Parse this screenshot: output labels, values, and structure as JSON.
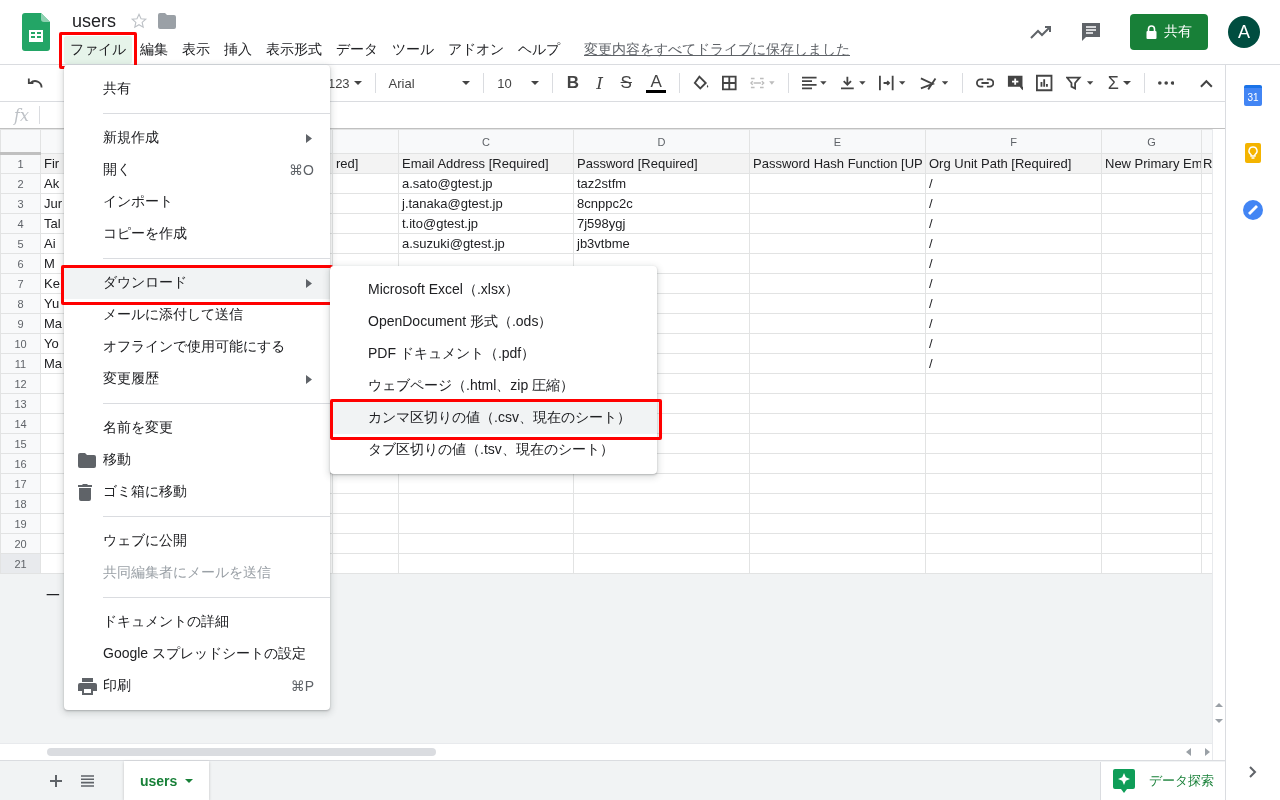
{
  "header": {
    "title": "users",
    "menu": [
      {
        "label": "ファイル",
        "selected": true,
        "annotated": true
      },
      {
        "label": "編集",
        "selected": false,
        "annotated": false
      },
      {
        "label": "表示",
        "selected": false,
        "annotated": false
      },
      {
        "label": "挿入",
        "selected": false,
        "annotated": false
      },
      {
        "label": "表示形式",
        "selected": false,
        "annotated": false
      },
      {
        "label": "データ",
        "selected": false,
        "annotated": false
      },
      {
        "label": "ツール",
        "selected": false,
        "annotated": false
      },
      {
        "label": "アドオン",
        "selected": false,
        "annotated": false
      },
      {
        "label": "ヘルプ",
        "selected": false,
        "annotated": false
      }
    ],
    "save_status": "変更内容をすべてドライブに保存しました",
    "share_button": "共有",
    "avatar_initial": "A"
  },
  "toolbar": {
    "number_format": "123",
    "font": "Arial",
    "font_size": "10",
    "bold": "B",
    "italic": "I",
    "strikethrough": "S",
    "text_color": "A",
    "functions": "Σ"
  },
  "formula_bar": {
    "label": "fx"
  },
  "table": {
    "column_letters": [
      "C",
      "D",
      "E",
      "F",
      "G"
    ],
    "rows": [
      {
        "number": "1",
        "selected": false,
        "shaded": true,
        "cells": {
          "A": "Fir",
          "B": "red]",
          "C": "Email Address [Required]",
          "D": "Password [Required]",
          "E": "Password Hash Function [UP",
          "F": "Org Unit Path [Required]",
          "G": "New Primary Em",
          "H": "R"
        }
      },
      {
        "number": "2",
        "selected": false,
        "shaded": false,
        "cells": {
          "A": "Ak",
          "C": "a.sato@gtest.jp",
          "D": "taz2stfm",
          "F": "/"
        }
      },
      {
        "number": "3",
        "selected": false,
        "shaded": false,
        "cells": {
          "A": "Jur",
          "C": "j.tanaka@gtest.jp",
          "D": "8cnppc2c",
          "F": "/"
        }
      },
      {
        "number": "4",
        "selected": false,
        "shaded": false,
        "cells": {
          "A": "Tal",
          "C": "t.ito@gtest.jp",
          "D": "7j598ygj",
          "F": "/"
        }
      },
      {
        "number": "5",
        "selected": false,
        "shaded": false,
        "cells": {
          "A": "Ai",
          "C": "a.suzuki@gtest.jp",
          "D": "jb3vtbme",
          "F": "/"
        }
      },
      {
        "number": "6",
        "selected": false,
        "shaded": false,
        "cells": {
          "A": "M",
          "F": "/"
        }
      },
      {
        "number": "7",
        "selected": false,
        "shaded": false,
        "cells": {
          "A": "Ke",
          "F": "/"
        }
      },
      {
        "number": "8",
        "selected": false,
        "shaded": false,
        "cells": {
          "A": "Yu",
          "F": "/"
        }
      },
      {
        "number": "9",
        "selected": false,
        "shaded": false,
        "cells": {
          "A": "Ma",
          "F": "/"
        }
      },
      {
        "number": "10",
        "selected": false,
        "shaded": false,
        "cells": {
          "A": "Yo",
          "F": "/"
        }
      },
      {
        "number": "11",
        "selected": false,
        "shaded": false,
        "cells": {
          "A": "Ma",
          "F": "/"
        }
      },
      {
        "number": "12",
        "selected": false,
        "shaded": false,
        "cells": {}
      },
      {
        "number": "13",
        "selected": false,
        "shaded": false,
        "cells": {}
      },
      {
        "number": "14",
        "selected": false,
        "shaded": false,
        "cells": {}
      },
      {
        "number": "15",
        "selected": false,
        "shaded": false,
        "cells": {}
      },
      {
        "number": "16",
        "selected": false,
        "shaded": false,
        "cells": {}
      },
      {
        "number": "17",
        "selected": false,
        "shaded": false,
        "cells": {}
      },
      {
        "number": "18",
        "selected": false,
        "shaded": false,
        "cells": {}
      },
      {
        "number": "19",
        "selected": false,
        "shaded": false,
        "cells": {}
      },
      {
        "number": "20",
        "selected": false,
        "shaded": false,
        "cells": {}
      },
      {
        "number": "21",
        "selected": true,
        "shaded": false,
        "cells": {}
      }
    ]
  },
  "below_grid_text": "一",
  "file_menu": {
    "items": [
      {
        "kind": "item",
        "label": "共有",
        "submenu": false,
        "highlighted": false,
        "disabled": false,
        "annotated": false
      },
      {
        "kind": "separator"
      },
      {
        "kind": "item",
        "label": "新規作成",
        "submenu": true,
        "highlighted": false,
        "disabled": false,
        "annotated": false
      },
      {
        "kind": "item",
        "label": "開く",
        "shortcut": "⌘O",
        "submenu": false,
        "highlighted": false,
        "disabled": false,
        "annotated": false
      },
      {
        "kind": "item",
        "label": "インポート",
        "submenu": false,
        "highlighted": false,
        "disabled": false,
        "annotated": false
      },
      {
        "kind": "item",
        "label": "コピーを作成",
        "submenu": false,
        "highlighted": false,
        "disabled": false,
        "annotated": false
      },
      {
        "kind": "separator"
      },
      {
        "kind": "item",
        "label": "ダウンロード",
        "submenu": true,
        "highlighted": true,
        "disabled": false,
        "annotated": true
      },
      {
        "kind": "item",
        "label": "メールに添付して送信",
        "submenu": false,
        "highlighted": false,
        "disabled": false,
        "annotated": false
      },
      {
        "kind": "item",
        "label": "オフラインで使用可能にする",
        "submenu": false,
        "highlighted": false,
        "disabled": false,
        "annotated": false
      },
      {
        "kind": "item",
        "label": "変更履歴",
        "submenu": true,
        "highlighted": false,
        "disabled": false,
        "annotated": false
      },
      {
        "kind": "separator"
      },
      {
        "kind": "item",
        "label": "名前を変更",
        "submenu": false,
        "highlighted": false,
        "disabled": false,
        "annotated": false
      },
      {
        "kind": "item",
        "label": "移動",
        "submenu": false,
        "highlighted": false,
        "disabled": false,
        "annotated": false
      },
      {
        "kind": "item",
        "label": "ゴミ箱に移動",
        "submenu": false,
        "highlighted": false,
        "disabled": false,
        "annotated": false
      },
      {
        "kind": "separator"
      },
      {
        "kind": "item",
        "label": "ウェブに公開",
        "submenu": false,
        "highlighted": false,
        "disabled": false,
        "annotated": false
      },
      {
        "kind": "item",
        "label": "共同編集者にメールを送信",
        "submenu": false,
        "highlighted": false,
        "disabled": true,
        "annotated": false
      },
      {
        "kind": "separator"
      },
      {
        "kind": "item",
        "label": "ドキュメントの詳細",
        "submenu": false,
        "highlighted": false,
        "disabled": false,
        "annotated": false
      },
      {
        "kind": "item",
        "label": "Google スプレッドシートの設定",
        "submenu": false,
        "highlighted": false,
        "disabled": false,
        "annotated": false
      },
      {
        "kind": "item",
        "label": "印刷",
        "shortcut": "⌘P",
        "submenu": false,
        "highlighted": false,
        "disabled": false,
        "annotated": false
      }
    ]
  },
  "download_submenu": {
    "items": [
      {
        "label": "Microsoft Excel（.xlsx）",
        "highlighted": false,
        "annotated": false
      },
      {
        "label": "OpenDocument 形式（.ods）",
        "highlighted": false,
        "annotated": false
      },
      {
        "label": "PDF ドキュメント（.pdf）",
        "highlighted": false,
        "annotated": false
      },
      {
        "label": "ウェブページ（.html、zip 圧縮）",
        "highlighted": false,
        "annotated": false
      },
      {
        "label": "カンマ区切りの値（.csv、現在のシート）",
        "highlighted": true,
        "annotated": true
      },
      {
        "label": "タブ区切りの値（.tsv、現在のシート）",
        "highlighted": false,
        "annotated": false
      }
    ]
  },
  "sheet_tabs": [
    {
      "label": "users",
      "selected": true
    }
  ],
  "explore_button": "データ探索",
  "side_panel": {
    "calendar_day": "31"
  }
}
